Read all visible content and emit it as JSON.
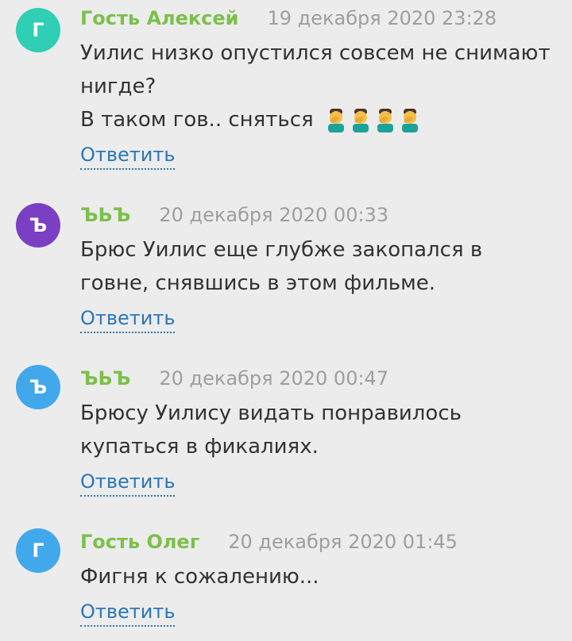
{
  "comments": [
    {
      "avatar_letter": "Г",
      "avatar_color": "#2ecfb4",
      "author": "Гость Алексей",
      "date": "19 декабря 2020 23:28",
      "lines": [
        "Уилис низко опустился совсем не снимают нигде?",
        "В таком гов.. сняться"
      ],
      "emoji": [
        "man-facepalming-icon",
        "man-facepalming-icon",
        "man-facepalming-icon",
        "man-facepalming-icon"
      ],
      "reply_label": "Ответить"
    },
    {
      "avatar_letter": "Ъ",
      "avatar_color": "#7b3fc4",
      "author": "ЪЬЪ",
      "date": "20 декабря 2020 00:33",
      "lines": [
        "Брюс Уилис еще глубже закопался в говне, снявшись в этом фильме."
      ],
      "reply_label": "Ответить"
    },
    {
      "avatar_letter": "Ъ",
      "avatar_color": "#42a8ec",
      "author": "ЪЬЪ",
      "date": "20 декабря 2020 00:47",
      "lines": [
        "Брюсу Уилису видать понравилось купаться в фикалиях."
      ],
      "reply_label": "Ответить"
    },
    {
      "avatar_letter": "Г",
      "avatar_color": "#42a8ec",
      "author": "Гость Олег",
      "date": "20 декабря 2020 01:45",
      "lines": [
        "Фигня к сожалению..."
      ],
      "reply_label": "Ответить"
    }
  ],
  "colors": {
    "background": "#ececec",
    "author": "#7cc04b",
    "date": "#9e9e9e",
    "text": "#333333",
    "link": "#2b77b9"
  }
}
